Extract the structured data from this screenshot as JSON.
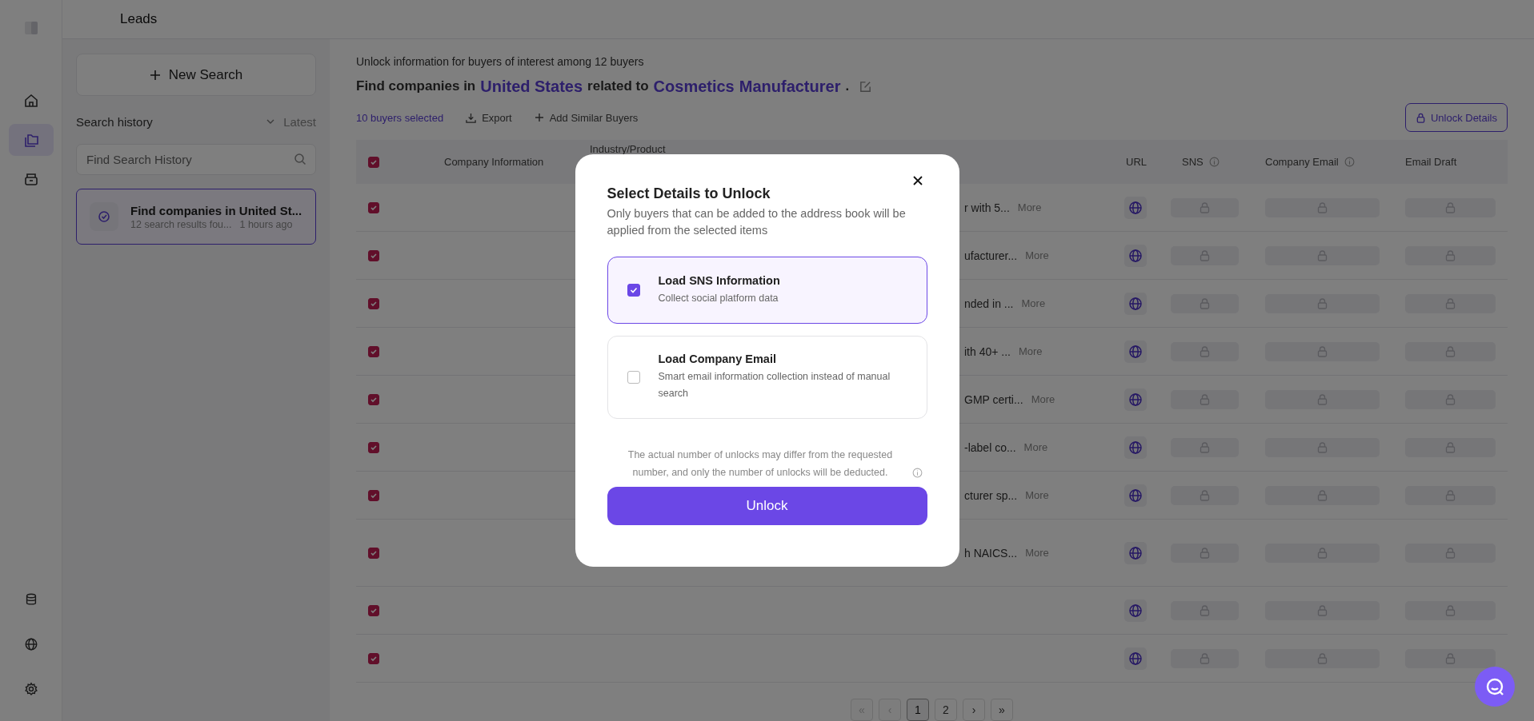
{
  "rail": {
    "top": [
      {
        "kind": "home",
        "selected": false
      },
      {
        "kind": "folder",
        "selected": true
      },
      {
        "kind": "archive",
        "selected": false
      }
    ],
    "bottom": [
      {
        "kind": "database",
        "selected": false
      },
      {
        "kind": "globe",
        "selected": false
      },
      {
        "kind": "settings",
        "selected": false
      }
    ]
  },
  "header": {
    "title": "Leads"
  },
  "history": {
    "new_search": "New Search",
    "title": "Search history",
    "sort": "Latest",
    "search": {
      "placeholder": "Find Search History"
    },
    "items": [
      {
        "title": "Find companies in United St...",
        "subtitle": "12 search results fou...",
        "time": "1 hours ago",
        "selected": true
      }
    ]
  },
  "main": {
    "intro": "Unlock information for buyers of interest among 12 buyers",
    "query": [
      {
        "text": "Find companies in",
        "highlight": false
      },
      {
        "text": "United States",
        "highlight": true
      },
      {
        "text": "related to",
        "highlight": false
      },
      {
        "text": "Cosmetics",
        "highlight": true
      },
      {
        "text": "Manufacturer",
        "highlight": true
      },
      {
        "text": ".",
        "highlight": false
      }
    ],
    "selected_count": "10 buyers selected",
    "actions": [
      {
        "kind": "export",
        "label": "Export"
      },
      {
        "kind": "add",
        "label": "Add Similar Buyers"
      }
    ],
    "unlock_details": "Unlock Details"
  },
  "table": {
    "header_checked": true,
    "columns": [
      {
        "label": "Company Information",
        "info": false
      },
      {
        "label": "Industry/Product",
        "info": false
      },
      {
        "label": "URL",
        "info": false
      },
      {
        "label": "SNS",
        "info": true
      },
      {
        "label": "Company Email",
        "info": true
      },
      {
        "label": "Email Draft",
        "info": false
      }
    ],
    "rows": [
      {
        "checked": true,
        "product": "r with 5...",
        "more": "More"
      },
      {
        "checked": true,
        "product": "ufacturer...",
        "more": "More"
      },
      {
        "checked": true,
        "product": "nded in ...",
        "more": "More"
      },
      {
        "checked": true,
        "product": "ith 40+ ...",
        "more": "More"
      },
      {
        "checked": true,
        "product": "GMP certi...",
        "more": "More"
      },
      {
        "checked": true,
        "product": "-label co...",
        "more": "More"
      },
      {
        "checked": true,
        "product": "cturer sp...",
        "more": "More"
      },
      {
        "checked": true,
        "product": "h NAICS...",
        "more": "More"
      },
      {
        "checked": true
      },
      {
        "checked": true
      }
    ]
  },
  "pagination": {
    "items": [
      {
        "label": "«",
        "disabled": true,
        "selected": false
      },
      {
        "label": "‹",
        "disabled": true,
        "selected": false
      },
      {
        "label": "1",
        "disabled": false,
        "selected": true
      },
      {
        "label": "2",
        "disabled": false,
        "selected": false
      },
      {
        "label": "›",
        "disabled": false,
        "selected": false
      },
      {
        "label": "»",
        "disabled": false,
        "selected": false
      }
    ]
  },
  "modal": {
    "title": "Select Details to Unlock",
    "description": "Only buyers that can be added to the address book will be applied from the selected items",
    "options": [
      {
        "title": "Load SNS Information",
        "description": "Collect social platform data",
        "checked": true
      },
      {
        "title": "Load Company Email",
        "description": "Smart email information collection instead of manual search",
        "checked": false
      }
    ],
    "note": "The actual number of unlocks may differ from the requested number, and only the number of unlocks will be deducted.",
    "button": "Unlock"
  }
}
